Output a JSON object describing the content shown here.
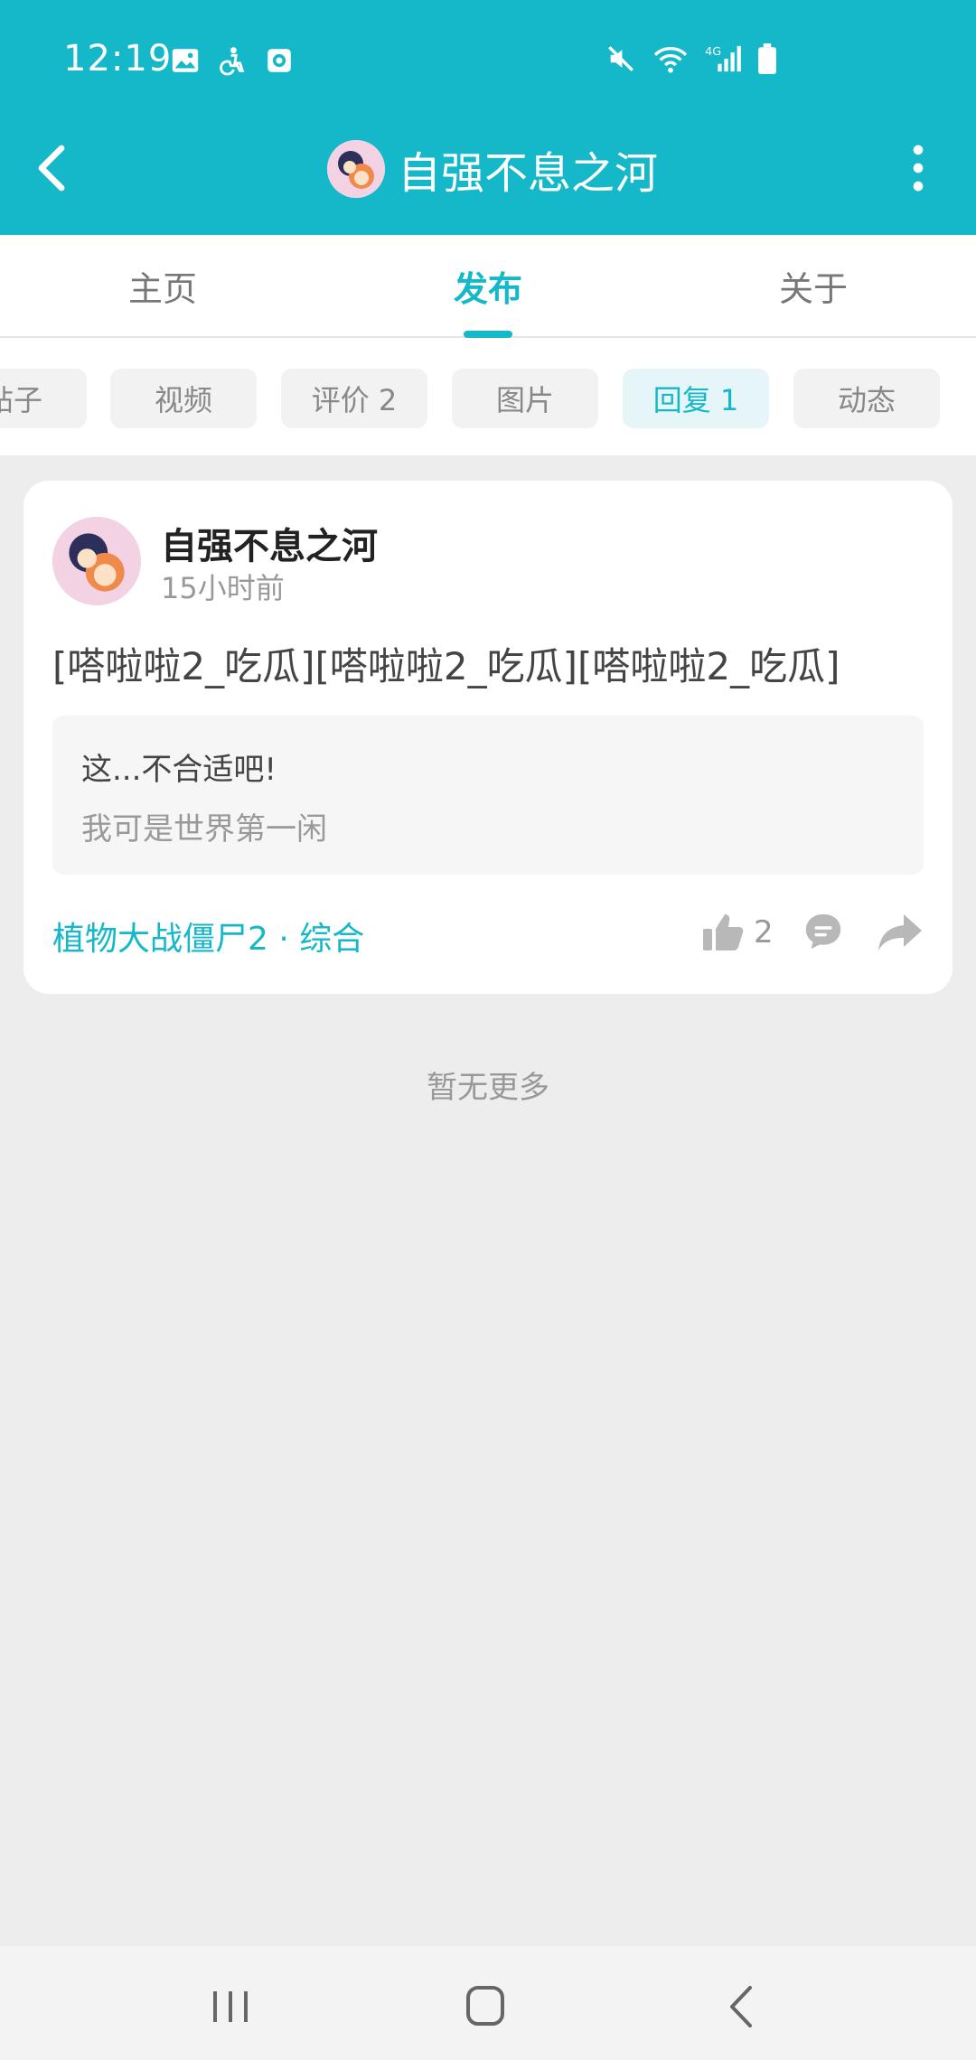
{
  "status_bar": {
    "time": "12:19"
  },
  "header": {
    "title": "自强不息之河"
  },
  "top_tabs": [
    {
      "label": "主页",
      "active": false
    },
    {
      "label": "发布",
      "active": true
    },
    {
      "label": "关于",
      "active": false
    }
  ],
  "sub_tabs": [
    {
      "label": "帖子",
      "active": false
    },
    {
      "label": "视频",
      "active": false
    },
    {
      "label": "评价 2",
      "active": false
    },
    {
      "label": "图片",
      "active": false
    },
    {
      "label": "回复 1",
      "active": true
    },
    {
      "label": "动态",
      "active": false
    }
  ],
  "post": {
    "username": "自强不息之河",
    "time": "15小时前",
    "content": "[嗒啦啦2_吃瓜][嗒啦啦2_吃瓜][嗒啦啦2_吃瓜]",
    "quote_main": "这...不合适吧!",
    "quote_sub": "我可是世界第一闲",
    "forum": "植物大战僵尸2 · 综合",
    "likes": "2"
  },
  "footer_text": "暂无更多",
  "colors": {
    "accent": "#15b8c8",
    "background": "#ededed"
  }
}
